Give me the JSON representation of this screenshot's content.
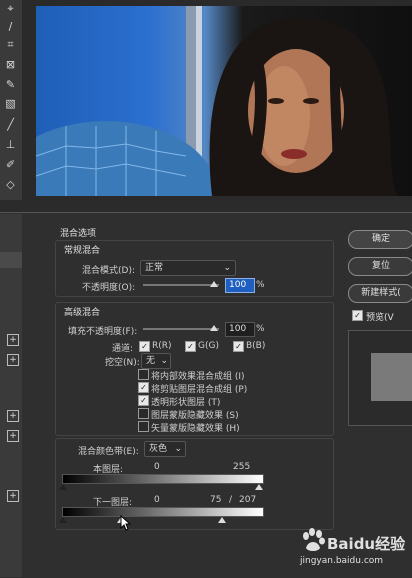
{
  "tools": [
    "lasso-icon",
    "brush-icon",
    "crop-icon",
    "frame-icon",
    "eyedropper-icon",
    "healing-icon",
    "brush-tool-icon",
    "stamp-icon",
    "history-brush-icon",
    "eraser-icon"
  ],
  "dialog": {
    "section_title": "混合选项",
    "general": {
      "title": "常规混合",
      "blend_mode_label": "混合模式(D):",
      "blend_mode_value": "正常",
      "opacity_label": "不透明度(O):",
      "opacity_value": "100",
      "percent": "%"
    },
    "advanced": {
      "title": "高级混合",
      "fill_opacity_label": "填充不透明度(F):",
      "fill_opacity_value": "100",
      "percent": "%",
      "channels_label": "通道:",
      "channel_r": "R(R)",
      "channel_g": "G(G)",
      "channel_b": "B(B)",
      "knockout_label": "挖空(N):",
      "knockout_value": "无",
      "options": [
        {
          "label": "将内部效果混合成组 (I)",
          "checked": false
        },
        {
          "label": "将剪贴图层混合成组 (P)",
          "checked": true
        },
        {
          "label": "透明形状图层 (T)",
          "checked": true
        },
        {
          "label": "图层蒙版隐藏效果 (S)",
          "checked": false
        },
        {
          "label": "矢量蒙版隐藏效果 (H)",
          "checked": false
        }
      ]
    },
    "blend_if": {
      "label": "混合颜色带(E):",
      "value": "灰色",
      "this_layer_label": "本图层:",
      "this_layer_min": "0",
      "this_layer_max": "255",
      "under_layer_label": "下一图层:",
      "under_layer_min": "0",
      "under_layer_split": "75",
      "slash": "/",
      "under_layer_max": "207"
    },
    "buttons": {
      "ok": "确定",
      "reset": "复位",
      "new_style": "新建样式(",
      "preview": "预览(V"
    }
  },
  "watermark": {
    "brand": "Baidu经验",
    "url": "jingyan.baidu.com"
  }
}
